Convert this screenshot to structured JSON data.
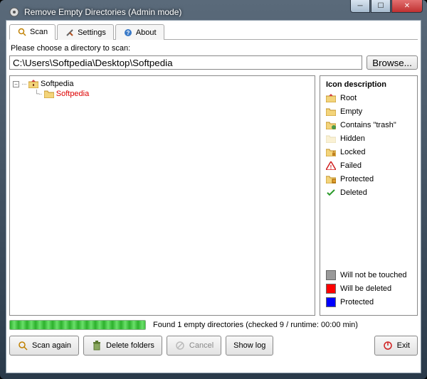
{
  "window": {
    "title": "Remove Empty Directories (Admin mode)"
  },
  "tabs": {
    "scan": "Scan",
    "settings": "Settings",
    "about": "About"
  },
  "scan_panel": {
    "choose_label": "Please choose a directory to scan:",
    "path_value": "C:\\Users\\Softpedia\\Desktop\\Softpedia",
    "browse_label": "Browse..."
  },
  "tree": {
    "root_label": "Softpedia",
    "child_label": "Softpedia"
  },
  "legend": {
    "title": "Icon description",
    "items": {
      "root": "Root",
      "empty": "Empty",
      "trash": "Contains \"trash\"",
      "hidden": "Hidden",
      "locked": "Locked",
      "failed": "Failed",
      "protected": "Protected",
      "deleted": "Deleted"
    },
    "colors": {
      "untouched": "Will not be touched",
      "deleted": "Will be deleted",
      "protected": "Protected"
    }
  },
  "status": {
    "progress_percent": 100,
    "text": "Found 1 empty directories (checked 9 / runtime: 00:00 min)"
  },
  "buttons": {
    "scan_again": "Scan again",
    "delete_folders": "Delete folders",
    "cancel": "Cancel",
    "show_log": "Show log",
    "exit": "Exit"
  }
}
